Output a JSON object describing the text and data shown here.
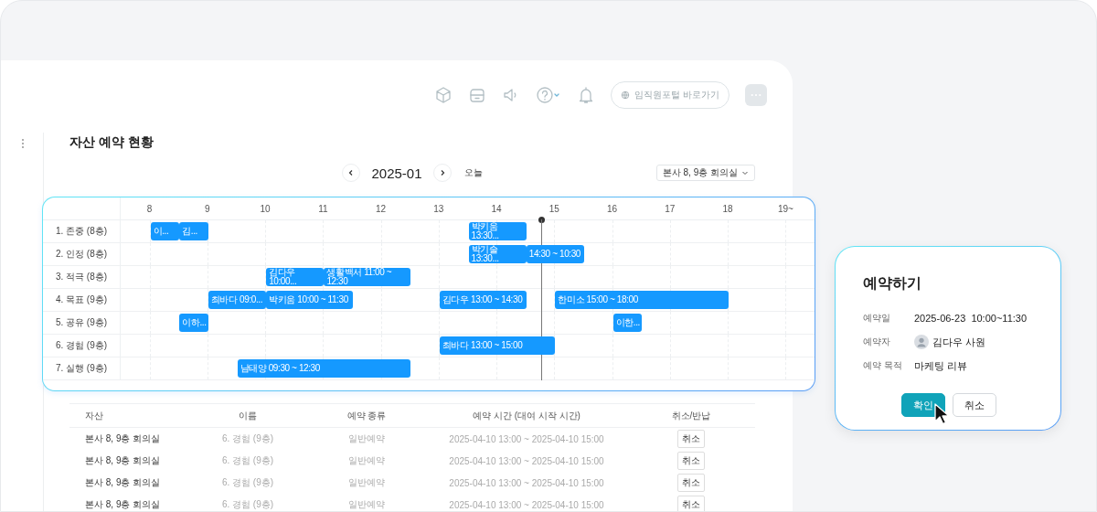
{
  "toolbar": {
    "portal_link": "임직원포털 바로가기"
  },
  "page_title": "자산 예약 현황",
  "month_nav": {
    "month": "2025-01",
    "today": "오늘"
  },
  "asset_select": {
    "value": "본사 8, 9층 회의실"
  },
  "timeline": {
    "hours": [
      "8",
      "9",
      "10",
      "11",
      "12",
      "13",
      "14",
      "15",
      "16",
      "17",
      "18",
      "19~"
    ],
    "rows": [
      {
        "label": "1. 존중 (8층)",
        "events": [
          {
            "text": "이..."
          },
          {
            "text": "김..."
          },
          {
            "text": "박키움 13:30..."
          }
        ]
      },
      {
        "label": "2. 인정 (8층)",
        "events": [
          {
            "text": "박기술 13:30..."
          },
          {
            "text": "14:30 ~ 10:30"
          }
        ]
      },
      {
        "label": "3. 적극 (8층)",
        "events": [
          {
            "text": "김다우 10:00..."
          },
          {
            "text": "생활백서 11:00 ~ 12:30"
          }
        ]
      },
      {
        "label": "4. 목표 (9층)",
        "events": [
          {
            "text": "최바다 09:0..."
          },
          {
            "text": "박키움 10:00 ~ 11:30"
          },
          {
            "text": "김다우 13:00 ~ 14:30"
          },
          {
            "text": "한미소 15:00 ~ 18:00"
          }
        ]
      },
      {
        "label": "5. 공유 (9층)",
        "events": [
          {
            "text": "이하..."
          },
          {
            "text": "이한..."
          }
        ]
      },
      {
        "label": "6. 경험 (9층)",
        "events": [
          {
            "text": "최바다 13:00 ~ 15:00"
          }
        ]
      },
      {
        "label": "7. 실행 (9층)",
        "events": [
          {
            "text": "남태양 09:30 ~ 12:30"
          }
        ]
      }
    ]
  },
  "table": {
    "columns": [
      "자산",
      "이름",
      "예약 종류",
      "예약 시간 (대여 시작 시간)",
      "취소/반납"
    ],
    "rows": [
      {
        "asset": "본사 8, 9층 회의실",
        "name": "6. 경험 (9층)",
        "type": "일반예약",
        "time": "2025-04-10 13:00 ~ 2025-04-10 15:00",
        "action": "취소"
      },
      {
        "asset": "본사 8, 9층 회의실",
        "name": "6. 경험 (9층)",
        "type": "일반예약",
        "time": "2025-04-10 13:00 ~ 2025-04-10 15:00",
        "action": "취소"
      },
      {
        "asset": "본사 8, 9층 회의실",
        "name": "6. 경험 (9층)",
        "type": "일반예약",
        "time": "2025-04-10 13:00 ~ 2025-04-10 15:00",
        "action": "취소"
      },
      {
        "asset": "본사 8, 9층 회의실",
        "name": "6. 경험 (9층)",
        "type": "일반예약",
        "time": "2025-04-10 13:00 ~ 2025-04-10 15:00",
        "action": "취소"
      }
    ]
  },
  "dialog": {
    "title": "예약하기",
    "fields": [
      {
        "label": "예약일",
        "value": "2025-06-23  10:00~11:30",
        "kind": "text"
      },
      {
        "label": "예약자",
        "value": "김다우 사원",
        "kind": "person"
      },
      {
        "label": "예약 목적",
        "value": "마케팅 리뷰",
        "kind": "text"
      }
    ],
    "buttons": [
      {
        "label": "확인",
        "primary": true
      },
      {
        "label": "취소",
        "primary": false
      }
    ]
  }
}
